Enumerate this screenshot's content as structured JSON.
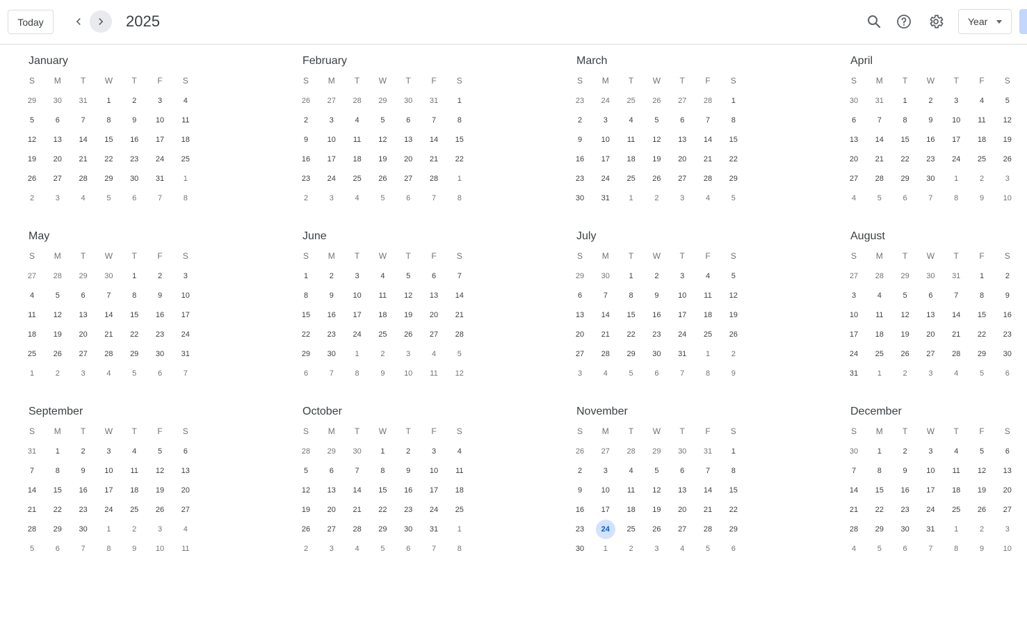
{
  "toolbar": {
    "today_label": "Today",
    "year": "2025",
    "view_label": "Year",
    "prev_icon": "chevron-left-icon",
    "next_icon": "chevron-right-icon",
    "search_icon": "search-icon",
    "help_icon": "help-icon",
    "settings_icon": "gear-icon"
  },
  "weekday_headers": [
    "S",
    "M",
    "T",
    "W",
    "T",
    "F",
    "S"
  ],
  "today_date": {
    "month": "November",
    "day": "24"
  },
  "colors": {
    "today_bg": "#d3e3fd",
    "today_text": "#0b57d0",
    "next_btn_bg": "#e8eaed"
  },
  "months": [
    {
      "name": "January",
      "weeks": [
        [
          "29",
          "30",
          "31",
          "1",
          "2",
          "3",
          "4"
        ],
        [
          "5",
          "6",
          "7",
          "8",
          "9",
          "10",
          "11"
        ],
        [
          "12",
          "13",
          "14",
          "15",
          "16",
          "17",
          "18"
        ],
        [
          "19",
          "20",
          "21",
          "22",
          "23",
          "24",
          "25"
        ],
        [
          "26",
          "27",
          "28",
          "29",
          "30",
          "31",
          "1"
        ],
        [
          "2",
          "3",
          "4",
          "5",
          "6",
          "7",
          "8"
        ]
      ]
    },
    {
      "name": "February",
      "weeks": [
        [
          "26",
          "27",
          "28",
          "29",
          "30",
          "31",
          "1"
        ],
        [
          "2",
          "3",
          "4",
          "5",
          "6",
          "7",
          "8"
        ],
        [
          "9",
          "10",
          "11",
          "12",
          "13",
          "14",
          "15"
        ],
        [
          "16",
          "17",
          "18",
          "19",
          "20",
          "21",
          "22"
        ],
        [
          "23",
          "24",
          "25",
          "26",
          "27",
          "28",
          "1"
        ],
        [
          "2",
          "3",
          "4",
          "5",
          "6",
          "7",
          "8"
        ]
      ]
    },
    {
      "name": "March",
      "weeks": [
        [
          "23",
          "24",
          "25",
          "26",
          "27",
          "28",
          "1"
        ],
        [
          "2",
          "3",
          "4",
          "5",
          "6",
          "7",
          "8"
        ],
        [
          "9",
          "10",
          "11",
          "12",
          "13",
          "14",
          "15"
        ],
        [
          "16",
          "17",
          "18",
          "19",
          "20",
          "21",
          "22"
        ],
        [
          "23",
          "24",
          "25",
          "26",
          "27",
          "28",
          "29"
        ],
        [
          "30",
          "31",
          "1",
          "2",
          "3",
          "4",
          "5"
        ]
      ]
    },
    {
      "name": "April",
      "weeks": [
        [
          "30",
          "31",
          "1",
          "2",
          "3",
          "4",
          "5"
        ],
        [
          "6",
          "7",
          "8",
          "9",
          "10",
          "11",
          "12"
        ],
        [
          "13",
          "14",
          "15",
          "16",
          "17",
          "18",
          "19"
        ],
        [
          "20",
          "21",
          "22",
          "23",
          "24",
          "25",
          "26"
        ],
        [
          "27",
          "28",
          "29",
          "30",
          "1",
          "2",
          "3"
        ],
        [
          "4",
          "5",
          "6",
          "7",
          "8",
          "9",
          "10"
        ]
      ]
    },
    {
      "name": "May",
      "weeks": [
        [
          "27",
          "28",
          "29",
          "30",
          "1",
          "2",
          "3"
        ],
        [
          "4",
          "5",
          "6",
          "7",
          "8",
          "9",
          "10"
        ],
        [
          "11",
          "12",
          "13",
          "14",
          "15",
          "16",
          "17"
        ],
        [
          "18",
          "19",
          "20",
          "21",
          "22",
          "23",
          "24"
        ],
        [
          "25",
          "26",
          "27",
          "28",
          "29",
          "30",
          "31"
        ],
        [
          "1",
          "2",
          "3",
          "4",
          "5",
          "6",
          "7"
        ]
      ]
    },
    {
      "name": "June",
      "weeks": [
        [
          "1",
          "2",
          "3",
          "4",
          "5",
          "6",
          "7"
        ],
        [
          "8",
          "9",
          "10",
          "11",
          "12",
          "13",
          "14"
        ],
        [
          "15",
          "16",
          "17",
          "18",
          "19",
          "20",
          "21"
        ],
        [
          "22",
          "23",
          "24",
          "25",
          "26",
          "27",
          "28"
        ],
        [
          "29",
          "30",
          "1",
          "2",
          "3",
          "4",
          "5"
        ],
        [
          "6",
          "7",
          "8",
          "9",
          "10",
          "11",
          "12"
        ]
      ]
    },
    {
      "name": "July",
      "weeks": [
        [
          "29",
          "30",
          "1",
          "2",
          "3",
          "4",
          "5"
        ],
        [
          "6",
          "7",
          "8",
          "9",
          "10",
          "11",
          "12"
        ],
        [
          "13",
          "14",
          "15",
          "16",
          "17",
          "18",
          "19"
        ],
        [
          "20",
          "21",
          "22",
          "23",
          "24",
          "25",
          "26"
        ],
        [
          "27",
          "28",
          "29",
          "30",
          "31",
          "1",
          "2"
        ],
        [
          "3",
          "4",
          "5",
          "6",
          "7",
          "8",
          "9"
        ]
      ]
    },
    {
      "name": "August",
      "weeks": [
        [
          "27",
          "28",
          "29",
          "30",
          "31",
          "1",
          "2"
        ],
        [
          "3",
          "4",
          "5",
          "6",
          "7",
          "8",
          "9"
        ],
        [
          "10",
          "11",
          "12",
          "13",
          "14",
          "15",
          "16"
        ],
        [
          "17",
          "18",
          "19",
          "20",
          "21",
          "22",
          "23"
        ],
        [
          "24",
          "25",
          "26",
          "27",
          "28",
          "29",
          "30"
        ],
        [
          "31",
          "1",
          "2",
          "3",
          "4",
          "5",
          "6"
        ]
      ]
    },
    {
      "name": "September",
      "weeks": [
        [
          "31",
          "1",
          "2",
          "3",
          "4",
          "5",
          "6"
        ],
        [
          "7",
          "8",
          "9",
          "10",
          "11",
          "12",
          "13"
        ],
        [
          "14",
          "15",
          "16",
          "17",
          "18",
          "19",
          "20"
        ],
        [
          "21",
          "22",
          "23",
          "24",
          "25",
          "26",
          "27"
        ],
        [
          "28",
          "29",
          "30",
          "1",
          "2",
          "3",
          "4"
        ],
        [
          "5",
          "6",
          "7",
          "8",
          "9",
          "10",
          "11"
        ]
      ]
    },
    {
      "name": "October",
      "weeks": [
        [
          "28",
          "29",
          "30",
          "1",
          "2",
          "3",
          "4"
        ],
        [
          "5",
          "6",
          "7",
          "8",
          "9",
          "10",
          "11"
        ],
        [
          "12",
          "13",
          "14",
          "15",
          "16",
          "17",
          "18"
        ],
        [
          "19",
          "20",
          "21",
          "22",
          "23",
          "24",
          "25"
        ],
        [
          "26",
          "27",
          "28",
          "29",
          "30",
          "31",
          "1"
        ],
        [
          "2",
          "3",
          "4",
          "5",
          "6",
          "7",
          "8"
        ]
      ]
    },
    {
      "name": "November",
      "weeks": [
        [
          "26",
          "27",
          "28",
          "29",
          "30",
          "31",
          "1"
        ],
        [
          "2",
          "3",
          "4",
          "5",
          "6",
          "7",
          "8"
        ],
        [
          "9",
          "10",
          "11",
          "12",
          "13",
          "14",
          "15"
        ],
        [
          "16",
          "17",
          "18",
          "19",
          "20",
          "21",
          "22"
        ],
        [
          "23",
          "24",
          "25",
          "26",
          "27",
          "28",
          "29"
        ],
        [
          "30",
          "1",
          "2",
          "3",
          "4",
          "5",
          "6"
        ]
      ]
    },
    {
      "name": "December",
      "weeks": [
        [
          "30",
          "1",
          "2",
          "3",
          "4",
          "5",
          "6"
        ],
        [
          "7",
          "8",
          "9",
          "10",
          "11",
          "12",
          "13"
        ],
        [
          "14",
          "15",
          "16",
          "17",
          "18",
          "19",
          "20"
        ],
        [
          "21",
          "22",
          "23",
          "24",
          "25",
          "26",
          "27"
        ],
        [
          "28",
          "29",
          "30",
          "31",
          "1",
          "2",
          "3"
        ],
        [
          "4",
          "5",
          "6",
          "7",
          "8",
          "9",
          "10"
        ]
      ]
    }
  ]
}
